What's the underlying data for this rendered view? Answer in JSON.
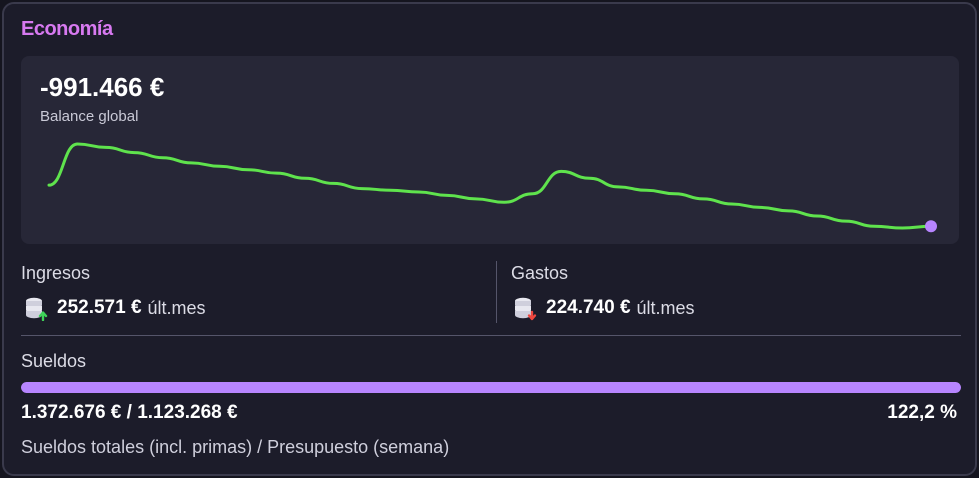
{
  "card": {
    "title": "Economía"
  },
  "balance": {
    "value": "-991.466 €",
    "label": "Balance global",
    "trend": [
      60,
      84,
      82,
      79,
      76,
      73,
      71,
      69,
      67,
      64,
      61,
      58,
      57,
      56,
      54,
      52,
      50,
      55,
      68,
      64,
      59,
      57,
      55,
      52,
      49,
      47,
      45,
      42,
      39,
      36,
      35,
      36
    ],
    "line_color": "#5fe34d",
    "marker_color": "#b785ff"
  },
  "ingresos": {
    "label": "Ingresos",
    "value": "252.571 €",
    "suffix": "últ.mes",
    "icon": "coins-up-icon"
  },
  "gastos": {
    "label": "Gastos",
    "value": "224.740 €",
    "suffix": "últ.mes",
    "icon": "coins-down-icon"
  },
  "sueldos": {
    "label": "Sueldos",
    "amounts": "1.372.676 € / 1.123.268 €",
    "percent": "122,2 %",
    "progress": 1.0,
    "caption": "Sueldos totales (incl. primas) / Presupuesto (semana)",
    "bar_color": "#b785ff"
  }
}
